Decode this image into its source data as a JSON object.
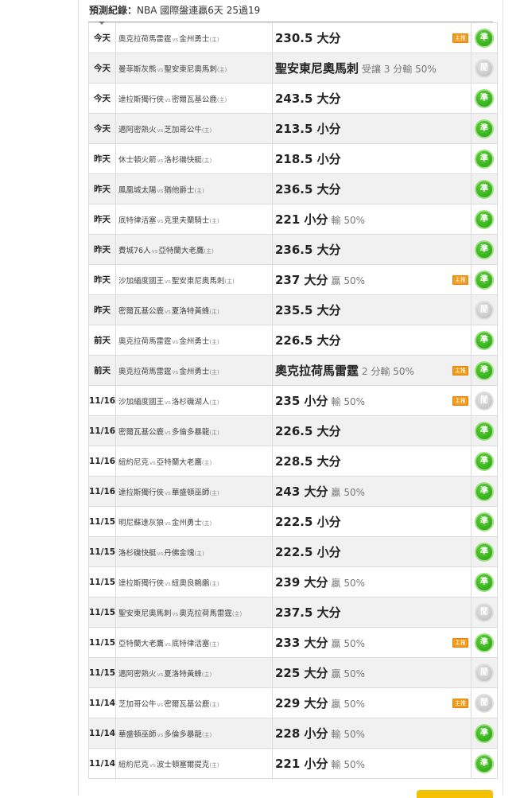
{
  "header": {
    "label": "預測紀錄：",
    "summary": "NBA 國際盤連贏6天 25過19"
  },
  "pro_tag": "主推",
  "colors": {
    "win": "#29a81a",
    "lose": "#c4c4c4",
    "pro": "#f19a18"
  },
  "rows": [
    {
      "day": "今天",
      "away": "奧克拉荷馬雷霆",
      "vs": "vs",
      "home": "金州勇士",
      "home_tag": "(主)",
      "pick": "230.5 大分",
      "sub": "",
      "pro": true,
      "badge": "準",
      "result": "win"
    },
    {
      "day": "今天",
      "away": "曼菲斯灰熊",
      "vs": "vs",
      "home": "聖安東尼奧馬刺",
      "home_tag": "(主)",
      "pick": "聖安東尼奧馬刺",
      "sub": "受讓 3 分輸 50%",
      "pro": false,
      "badge": "閒",
      "result": "lose"
    },
    {
      "day": "今天",
      "away": "達拉斯獨行俠",
      "vs": "vs",
      "home": "密爾瓦基公鹿",
      "home_tag": "(主)",
      "pick": "243.5 大分",
      "sub": "",
      "pro": false,
      "badge": "準",
      "result": "win"
    },
    {
      "day": "今天",
      "away": "邁阿密熱火",
      "vs": "vs",
      "home": "芝加哥公牛",
      "home_tag": "(主)",
      "pick": "213.5 小分",
      "sub": "",
      "pro": false,
      "badge": "準",
      "result": "win"
    },
    {
      "day": "昨天",
      "away": "休士頓火箭",
      "vs": "vs",
      "home": "洛杉磯快艇",
      "home_tag": "(主)",
      "pick": "218.5 小分",
      "sub": "",
      "pro": false,
      "badge": "準",
      "result": "win"
    },
    {
      "day": "昨天",
      "away": "鳳凰城太陽",
      "vs": "vs",
      "home": "猶他爵士",
      "home_tag": "(主)",
      "pick": "236.5 大分",
      "sub": "",
      "pro": false,
      "badge": "準",
      "result": "win"
    },
    {
      "day": "昨天",
      "away": "底特律活塞",
      "vs": "vs",
      "home": "克里夫蘭騎士",
      "home_tag": "(主)",
      "pick": "221 小分",
      "sub": "輸 50%",
      "pro": false,
      "badge": "準",
      "result": "win"
    },
    {
      "day": "昨天",
      "away": "費城76人",
      "vs": "vs",
      "home": "亞特蘭大老鷹",
      "home_tag": "(主)",
      "pick": "236.5 大分",
      "sub": "",
      "pro": false,
      "badge": "準",
      "result": "win"
    },
    {
      "day": "昨天",
      "away": "沙加緬度國王",
      "vs": "vs",
      "home": "聖安東尼奧馬刺",
      "home_tag": "(主)",
      "pick": "237 大分",
      "sub": "贏 50%",
      "pro": true,
      "badge": "準",
      "result": "win"
    },
    {
      "day": "昨天",
      "away": "密爾瓦基公鹿",
      "vs": "vs",
      "home": "夏洛特黃蜂",
      "home_tag": "(主)",
      "pick": "235.5 大分",
      "sub": "",
      "pro": false,
      "badge": "閒",
      "result": "lose"
    },
    {
      "day": "前天",
      "away": "奧克拉荷馬雷霆",
      "vs": "vs",
      "home": "金州勇士",
      "home_tag": "(主)",
      "pick": "226.5 大分",
      "sub": "",
      "pro": false,
      "badge": "準",
      "result": "win"
    },
    {
      "day": "前天",
      "away": "奧克拉荷馬雷霆",
      "vs": "vs",
      "home": "金州勇士",
      "home_tag": "(主)",
      "pick": "奧克拉荷馬雷霆",
      "sub": "2 分輸 50%",
      "pro": true,
      "badge": "準",
      "result": "win"
    },
    {
      "day": "11/16",
      "away": "沙加緬度國王",
      "vs": "vs",
      "home": "洛杉磯湖人",
      "home_tag": "(主)",
      "pick": "235 小分",
      "sub": "輸 50%",
      "pro": true,
      "badge": "閒",
      "result": "lose"
    },
    {
      "day": "11/16",
      "away": "密爾瓦基公鹿",
      "vs": "vs",
      "home": "多倫多暴龍",
      "home_tag": "(主)",
      "pick": "226.5 大分",
      "sub": "",
      "pro": false,
      "badge": "準",
      "result": "win"
    },
    {
      "day": "11/16",
      "away": "紐約尼克",
      "vs": "vs",
      "home": "亞特蘭大老鷹",
      "home_tag": "(主)",
      "pick": "228.5 大分",
      "sub": "",
      "pro": false,
      "badge": "準",
      "result": "win"
    },
    {
      "day": "11/16",
      "away": "達拉斯獨行俠",
      "vs": "vs",
      "home": "華盛頓巫師",
      "home_tag": "(主)",
      "pick": "243 大分",
      "sub": "贏 50%",
      "pro": false,
      "badge": "準",
      "result": "win"
    },
    {
      "day": "11/15",
      "away": "明尼蘇達灰狼",
      "vs": "vs",
      "home": "金州勇士",
      "home_tag": "(主)",
      "pick": "222.5 小分",
      "sub": "",
      "pro": false,
      "badge": "準",
      "result": "win"
    },
    {
      "day": "11/15",
      "away": "洛杉磯快艇",
      "vs": "vs",
      "home": "丹佛金塊",
      "home_tag": "(主)",
      "pick": "222.5 小分",
      "sub": "",
      "pro": false,
      "badge": "準",
      "result": "win"
    },
    {
      "day": "11/15",
      "away": "達拉斯獨行俠",
      "vs": "vs",
      "home": "紐奧良鵜鶘",
      "home_tag": "(主)",
      "pick": "239 大分",
      "sub": "贏 50%",
      "pro": false,
      "badge": "準",
      "result": "win"
    },
    {
      "day": "11/15",
      "away": "聖安東尼奧馬刺",
      "vs": "vs",
      "home": "奧克拉荷馬雷霆",
      "home_tag": "(主)",
      "pick": "237.5 大分",
      "sub": "",
      "pro": false,
      "badge": "閒",
      "result": "lose"
    },
    {
      "day": "11/15",
      "away": "亞特蘭大老鷹",
      "vs": "vs",
      "home": "底特律活塞",
      "home_tag": "(主)",
      "pick": "233 大分",
      "sub": "贏 50%",
      "pro": true,
      "badge": "準",
      "result": "win"
    },
    {
      "day": "11/15",
      "away": "邁阿密熱火",
      "vs": "vs",
      "home": "夏洛特黃蜂",
      "home_tag": "(主)",
      "pick": "225 大分",
      "sub": "贏 50%",
      "pro": false,
      "badge": "閒",
      "result": "lose"
    },
    {
      "day": "11/14",
      "away": "芝加哥公牛",
      "vs": "vs",
      "home": "密爾瓦基公鹿",
      "home_tag": "(主)",
      "pick": "229 大分",
      "sub": "贏 50%",
      "pro": true,
      "badge": "閒",
      "result": "lose"
    },
    {
      "day": "11/14",
      "away": "華盛頓巫師",
      "vs": "vs",
      "home": "多倫多暴龍",
      "home_tag": "(主)",
      "pick": "228 小分",
      "sub": "輸 50%",
      "pro": false,
      "badge": "準",
      "result": "win"
    },
    {
      "day": "11/14",
      "away": "紐約尼克",
      "vs": "vs",
      "home": "波士頓塞爾提克",
      "home_tag": "(主)",
      "pick": "221 小分",
      "sub": "輸 50%",
      "pro": false,
      "badge": "準",
      "result": "win"
    }
  ]
}
